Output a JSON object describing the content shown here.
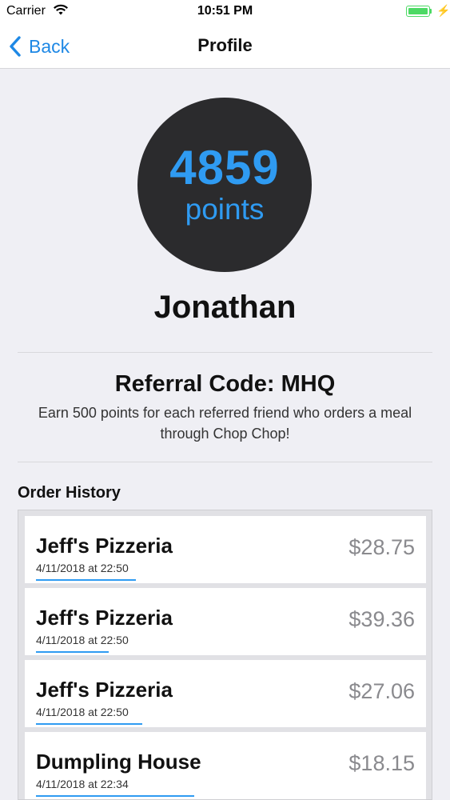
{
  "status_bar": {
    "carrier": "Carrier",
    "time": "10:51 PM"
  },
  "nav": {
    "back_label": "Back",
    "title": "Profile"
  },
  "points": {
    "value": "4859",
    "unit": "points"
  },
  "user": {
    "name": "Jonathan"
  },
  "referral": {
    "title": "Referral Code: MHQ",
    "description": "Earn 500 points for each referred friend who orders a meal through Chop Chop!"
  },
  "order_history": {
    "title": "Order History",
    "orders": [
      {
        "restaurant": "Jeff's Pizzeria",
        "date": "4/11/2018 at 22:50",
        "price": "$28.75"
      },
      {
        "restaurant": "Jeff's Pizzeria",
        "date": "4/11/2018 at 22:50",
        "price": "$39.36"
      },
      {
        "restaurant": "Jeff's Pizzeria",
        "date": "4/11/2018 at 22:50",
        "price": "$27.06"
      },
      {
        "restaurant": "Dumpling House",
        "date": "4/11/2018 at 22:34",
        "price": "$18.15"
      }
    ]
  },
  "colors": {
    "accent": "#2f9bf2",
    "circle": "#2b2b2d",
    "battery": "#4cd964"
  }
}
